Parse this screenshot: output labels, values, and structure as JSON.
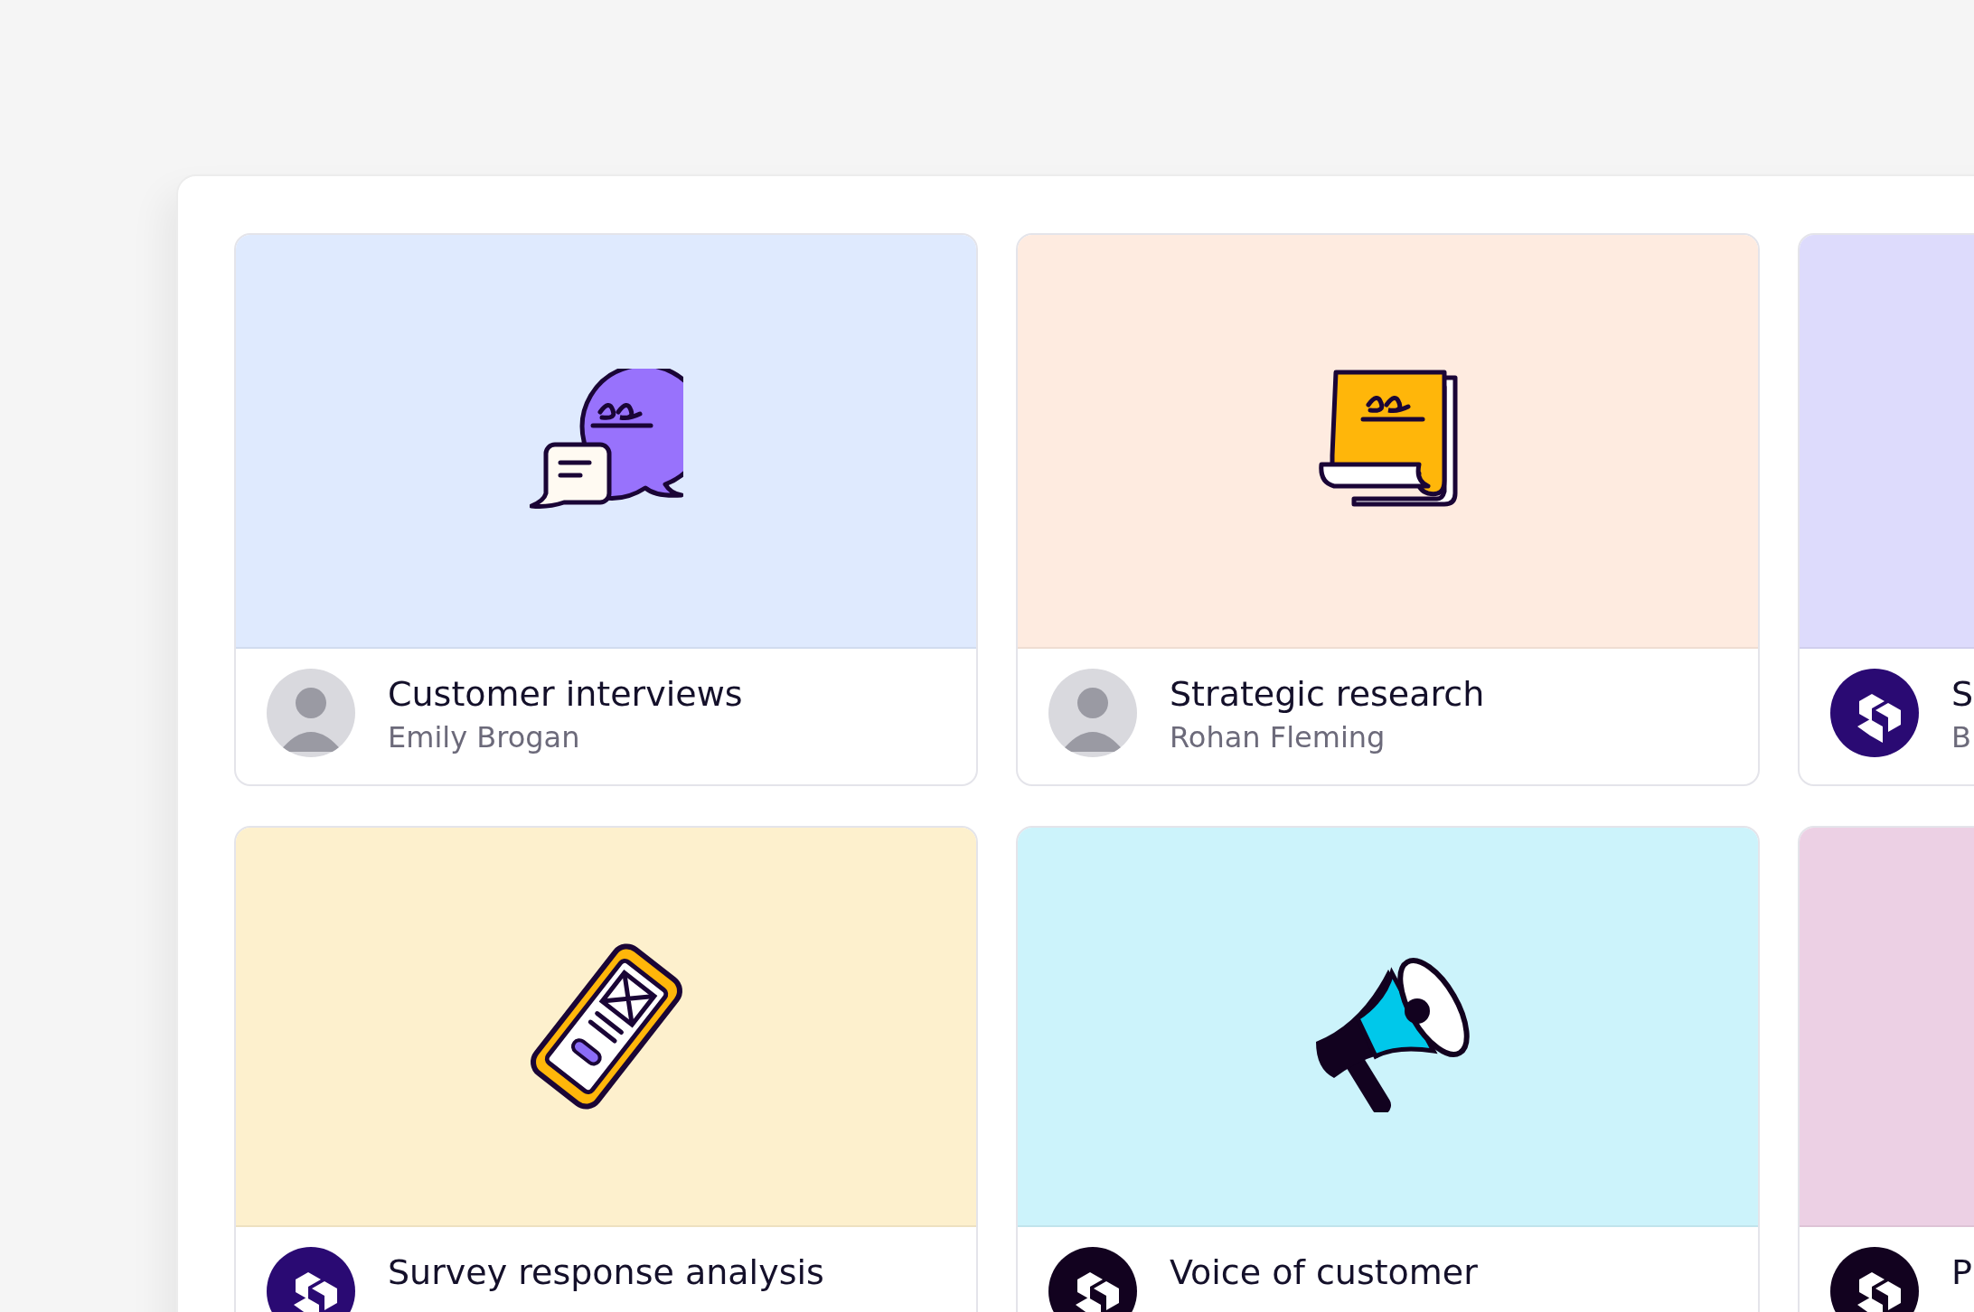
{
  "cards": [
    {
      "title": "Customer interviews",
      "author": "Emily Brogan",
      "color": "#dfeafe",
      "kind": "chat",
      "avatar": {
        "kind": "photo"
      }
    },
    {
      "title": "Strategic research",
      "author": "Rohan Fleming",
      "color": "#feebe0",
      "kind": "document",
      "avatar": {
        "kind": "photo"
      }
    },
    {
      "title": "S",
      "author": "B",
      "color": "#dddbfc",
      "kind": "blank",
      "avatar": {
        "kind": "logo",
        "color": "#2a0a73"
      }
    },
    {
      "title": "Survey response analysis",
      "color": "#fdf0cd",
      "kind": "phone",
      "avatar": {
        "kind": "logo",
        "color": "#2a0a73"
      }
    },
    {
      "title": "Voice of customer",
      "color": "#ccf3fb",
      "kind": "megaphone",
      "avatar": {
        "kind": "logo",
        "color": "#12021f"
      }
    },
    {
      "title": "P",
      "color": "#ecd0e4",
      "kind": "blank",
      "avatar": {
        "kind": "logo",
        "color": "#12021f"
      }
    }
  ]
}
